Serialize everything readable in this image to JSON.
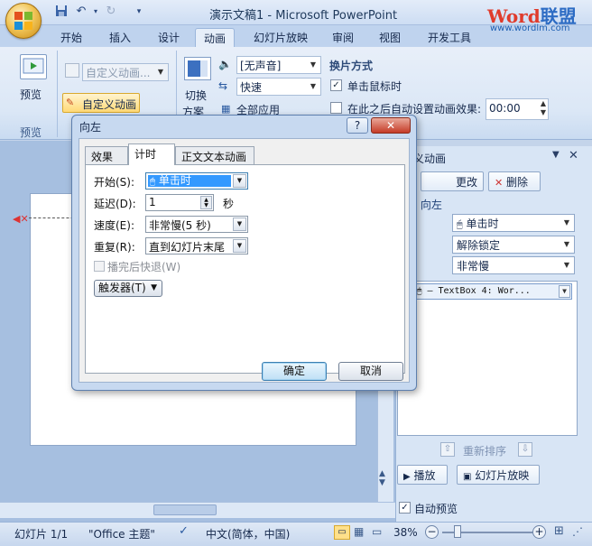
{
  "window": {
    "title": "演示文稿1 - Microsoft PowerPoint",
    "brand_word": "Word",
    "brand_cn": "联盟",
    "brand_url": "www.wordlm.com"
  },
  "tabs": [
    "开始",
    "插入",
    "设计",
    "动画",
    "幻灯片放映",
    "审阅",
    "视图",
    "开发工具"
  ],
  "active_tab": "动画",
  "ribbon": {
    "preview_label": "预览",
    "preview_group": "预览",
    "custom_anim_combo": "自定义动画...",
    "custom_anim_button": "自定义动画",
    "switch_label_1": "切换",
    "switch_label_2": "方案",
    "sound_combo": "[无声音]",
    "speed_combo": "快速",
    "apply_all": "全部应用",
    "advance_title": "换片方式",
    "on_click": "单击鼠标时",
    "auto_after": "在此之后自动设置动画效果:",
    "auto_time": "00:00"
  },
  "pane": {
    "title": "义动画",
    "change_btn": "更改",
    "delete_btn": "删除",
    "effect_name": ": 向左",
    "start_value": "单击时",
    "direction_value": "解除锁定",
    "speed_value": "非常慢",
    "list_item": "— TextBox 4: Wor...",
    "reorder": "重新排序",
    "play_btn": "播放",
    "slideshow_btn": "幻灯片放映",
    "auto_preview": "自动预览"
  },
  "status": {
    "slide": "幻灯片 1/1",
    "theme": "\"Office 主题\"",
    "language": "中文(简体，中国)",
    "zoom": "38%"
  },
  "dialog": {
    "title": "向左",
    "help": "?",
    "close": "✕",
    "tabs": [
      "效果",
      "计时",
      "正文文本动画"
    ],
    "active_tab": "计时",
    "start_label": "开始(S):",
    "start_value": "单击时",
    "delay_label": "延迟(D):",
    "delay_value": "1",
    "delay_unit": "秒",
    "speed_label": "速度(E):",
    "speed_value": "非常慢(5 秒)",
    "repeat_label": "重复(R):",
    "repeat_value": "直到幻灯片末尾",
    "rewind_label": "播完后快退(W)",
    "trigger_label": "触发器(T)",
    "ok": "确定",
    "cancel": "取消"
  }
}
